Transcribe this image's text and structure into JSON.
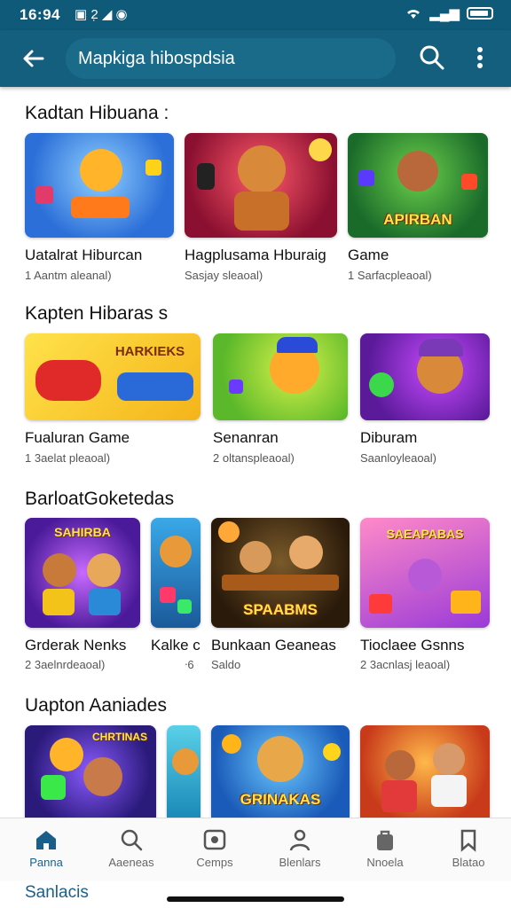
{
  "status_bar": {
    "time": "16:94",
    "icons_left": "▣ 2̣ ◢ ◉",
    "signal_text": "▂▄▆"
  },
  "app_bar": {
    "search_text": "Mapkiga hibospdsia"
  },
  "sections": [
    {
      "title": "Kadtan Hibuana :",
      "cards": [
        {
          "title": "Uatalrat Hiburcan",
          "sub": "1 Aantm aleanal)",
          "bg": "#2c8bd8",
          "label": ""
        },
        {
          "title": "Hagplusama Hburaig",
          "sub": "Sasjay sleaoal)",
          "bg": "#a01a3a",
          "label": ""
        },
        {
          "title": "Game",
          "sub": "1 Sarfacpleaoal)",
          "bg": "#1f7a3a",
          "label": "APIRBAN"
        }
      ]
    },
    {
      "title": "Kapten Hibaras s",
      "cards": [
        {
          "title": "Fualuran Game",
          "sub": "1 3aelat pleaoal)",
          "bg": "#f4c316",
          "label": "HARKIEKS"
        },
        {
          "title": "Senanran",
          "sub": "2 oltanspleaoal)",
          "bg": "#7fc43a",
          "label": ""
        },
        {
          "title": "Diburam",
          "sub": "Saanloyleaoal)",
          "bg": "#8a3ac4",
          "label": ""
        }
      ]
    },
    {
      "title": "BarloatGoketedas",
      "cards": [
        {
          "title": "Grderak Nenks",
          "sub": "2 3aelnrdeaoal)",
          "bg": "#7b3ab8",
          "label": "SAHIRBA"
        },
        {
          "title": "Kalke c",
          "sub": "ᐧ6",
          "bg": "#2a9ad0",
          "label": ""
        },
        {
          "title": "Bunkaan Geaneas",
          "sub": "Saldo",
          "bg": "#3a2a1a",
          "label": "SPAABMS"
        },
        {
          "title": "Tioclaee Gsnns",
          "sub": "2 3acnlasj leaoal)",
          "bg": "#e96aa8",
          "label": "SAEAPABAS"
        }
      ]
    },
    {
      "title": "Uapton Aaniades",
      "cards": [
        {
          "title": "",
          "sub": "",
          "bg": "#4a3ab0",
          "label": "CHRTINAS"
        },
        {
          "title": "",
          "sub": "",
          "bg": "#2fa8c8",
          "label": ""
        },
        {
          "title": "",
          "sub": "",
          "bg": "#1c8ad0",
          "label": "GRINAKAS"
        },
        {
          "title": "",
          "sub": "",
          "bg": "#ea6a2a",
          "label": ""
        }
      ]
    }
  ],
  "bottom_nav": [
    {
      "label": "Panna",
      "icon": "home-icon"
    },
    {
      "label": "Aaeneas",
      "icon": "search-icon"
    },
    {
      "label": "Cemps",
      "icon": "gamepad-icon"
    },
    {
      "label": "Blenlars",
      "icon": "person-icon"
    },
    {
      "label": "Nnoela",
      "icon": "bag-icon"
    },
    {
      "label": "Blatao",
      "icon": "bookmark-icon"
    }
  ],
  "footer": {
    "text": "Sanlacis"
  },
  "colors": {
    "app_bar": "#145f7e",
    "status_bar": "#0f5a78",
    "accent": "#1a5f8a"
  }
}
